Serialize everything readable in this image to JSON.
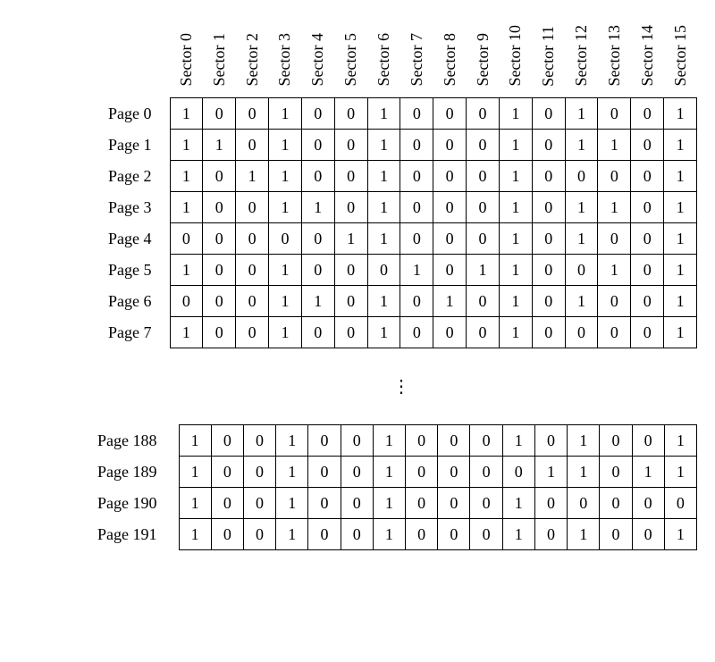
{
  "columns": [
    "Sector 0",
    "Sector 1",
    "Sector 2",
    "Sector 3",
    "Sector 4",
    "Sector 5",
    "Sector 6",
    "Sector 7",
    "Sector 8",
    "Sector 9",
    "Sector 10",
    "Sector 11",
    "Sector 12",
    "Sector 13",
    "Sector 14",
    "Sector 15"
  ],
  "ellipsis": "⋮",
  "rowsTop": [
    {
      "label": "Page 0",
      "cells": [
        "1",
        "0",
        "0",
        "1",
        "0",
        "0",
        "1",
        "0",
        "0",
        "0",
        "1",
        "0",
        "1",
        "0",
        "0",
        "1"
      ]
    },
    {
      "label": "Page 1",
      "cells": [
        "1",
        "1",
        "0",
        "1",
        "0",
        "0",
        "1",
        "0",
        "0",
        "0",
        "1",
        "0",
        "1",
        "1",
        "0",
        "1"
      ]
    },
    {
      "label": "Page 2",
      "cells": [
        "1",
        "0",
        "1",
        "1",
        "0",
        "0",
        "1",
        "0",
        "0",
        "0",
        "1",
        "0",
        "0",
        "0",
        "0",
        "1"
      ]
    },
    {
      "label": "Page 3",
      "cells": [
        "1",
        "0",
        "0",
        "1",
        "1",
        "0",
        "1",
        "0",
        "0",
        "0",
        "1",
        "0",
        "1",
        "1",
        "0",
        "1"
      ]
    },
    {
      "label": "Page 4",
      "cells": [
        "0",
        "0",
        "0",
        "0",
        "0",
        "1",
        "1",
        "0",
        "0",
        "0",
        "1",
        "0",
        "1",
        "0",
        "0",
        "1"
      ]
    },
    {
      "label": "Page 5",
      "cells": [
        "1",
        "0",
        "0",
        "1",
        "0",
        "0",
        "0",
        "1",
        "0",
        "1",
        "1",
        "0",
        "0",
        "1",
        "0",
        "1"
      ]
    },
    {
      "label": "Page 6",
      "cells": [
        "0",
        "0",
        "0",
        "1",
        "1",
        "0",
        "1",
        "0",
        "1",
        "0",
        "1",
        "0",
        "1",
        "0",
        "0",
        "1"
      ]
    },
    {
      "label": "Page 7",
      "cells": [
        "1",
        "0",
        "0",
        "1",
        "0",
        "0",
        "1",
        "0",
        "0",
        "0",
        "1",
        "0",
        "0",
        "0",
        "0",
        "1"
      ]
    }
  ],
  "rowsBottom": [
    {
      "label": "Page 188",
      "cells": [
        "1",
        "0",
        "0",
        "1",
        "0",
        "0",
        "1",
        "0",
        "0",
        "0",
        "1",
        "0",
        "1",
        "0",
        "0",
        "1"
      ]
    },
    {
      "label": "Page 189",
      "cells": [
        "1",
        "0",
        "0",
        "1",
        "0",
        "0",
        "1",
        "0",
        "0",
        "0",
        "0",
        "1",
        "1",
        "0",
        "1",
        "1"
      ]
    },
    {
      "label": "Page 190",
      "cells": [
        "1",
        "0",
        "0",
        "1",
        "0",
        "0",
        "1",
        "0",
        "0",
        "0",
        "1",
        "0",
        "0",
        "0",
        "0",
        "0"
      ]
    },
    {
      "label": "Page 191",
      "cells": [
        "1",
        "0",
        "0",
        "1",
        "0",
        "0",
        "1",
        "0",
        "0",
        "0",
        "1",
        "0",
        "1",
        "0",
        "0",
        "1"
      ]
    }
  ]
}
